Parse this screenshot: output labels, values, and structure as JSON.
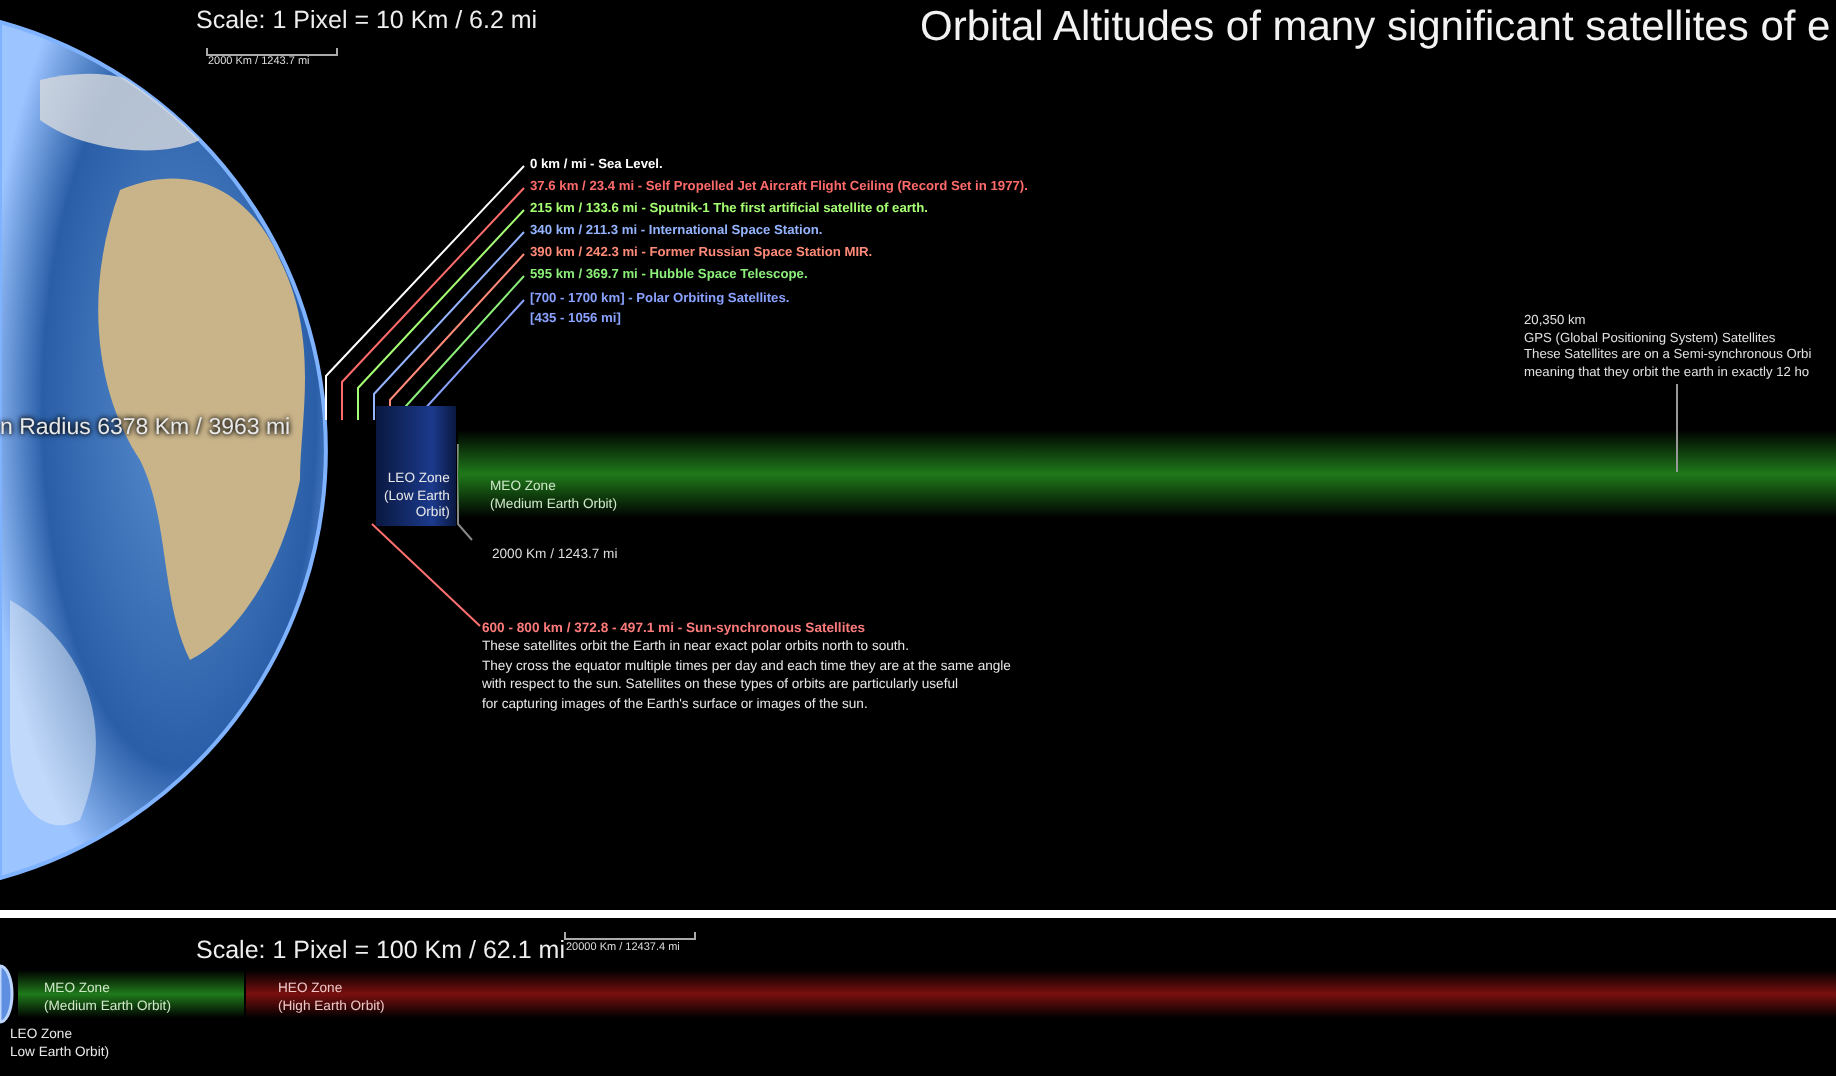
{
  "top_panel": {
    "scale_label": "Scale: 1 Pixel = 10 Km / 6.2 mi",
    "scale_bar_label": "2000 Km / 1243.7 mi",
    "title": "Orbital Altitudes of many significant satellites of e",
    "earth_label": "n Radius 6378 Km / 3963 mi",
    "altitudes": [
      {
        "lines": [
          "0 km / mi - Sea Level."
        ],
        "color": "#ffffff"
      },
      {
        "lines": [
          "37.6 km / 23.4 mi - Self Propelled Jet Aircraft Flight Ceiling (Record Set in 1977)."
        ],
        "color": "#ff6b6b"
      },
      {
        "lines": [
          "215 km / 133.6 mi - Sputnik-1 The first artificial satellite of earth."
        ],
        "color": "#a6ff73"
      },
      {
        "lines": [
          "340 km / 211.3 mi - International Space Station."
        ],
        "color": "#94b4ff"
      },
      {
        "lines": [
          "390 km / 242.3 mi - Former Russian Space Station MIR."
        ],
        "color": "#ff8a78"
      },
      {
        "lines": [
          "595 km / 369.7 mi - Hubble Space Telescope."
        ],
        "color": "#8cf07a"
      },
      {
        "lines": [
          "[700 - 1700 km] - Polar Orbiting Satellites.",
          "[435 - 1056 mi]"
        ],
        "color": "#8aa2ff"
      }
    ],
    "zones": [
      {
        "kind": "leo",
        "lines": [
          "LEO Zone",
          "(Low Earth",
          "Orbit)"
        ]
      },
      {
        "kind": "meo",
        "lines": [
          "MEO Zone",
          "(Medium Earth Orbit)"
        ]
      }
    ],
    "boundary_label": "2000 Km / 1243.7 mi",
    "sun_synchronous": {
      "title": "600 - 800 km / 372.8 - 497.1 mi - Sun-synchronous Satellites",
      "lines": [
        "These satellites orbit the Earth in near exact polar orbits north to south.",
        "They cross the equator multiple times per day and each time they are at the same angle",
        "with respect to the sun.  Satellites on these types of orbits are particularly useful",
        "for capturing images of the Earth's surface or images of the sun."
      ]
    },
    "gps": {
      "lines": [
        "20,350 km",
        "GPS (Global Positioning System) Satellites",
        "These Satellites are on a Semi-synchronous Orbi",
        "meaning that they orbit the earth in exactly 12 ho"
      ]
    }
  },
  "bottom_panel": {
    "scale_label": "Scale: 1 Pixel = 100 Km / 62.1 mi",
    "scale_bar_label": "20000 Km / 12437.4 mi",
    "zones": [
      {
        "kind": "meo",
        "lines": [
          "MEO Zone",
          "(Medium Earth Orbit)"
        ]
      },
      {
        "kind": "heo",
        "lines": [
          "HEO Zone",
          "(High Earth Orbit)"
        ]
      },
      {
        "kind": "leo",
        "lines": [
          "LEO Zone",
          "Low Earth Orbit)"
        ]
      }
    ]
  }
}
